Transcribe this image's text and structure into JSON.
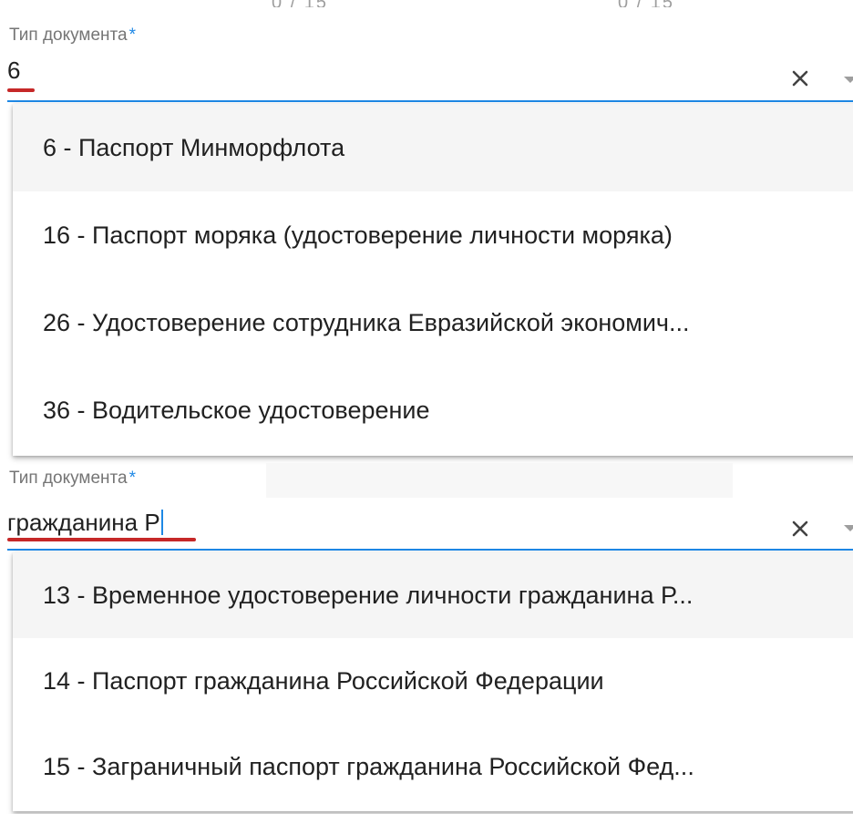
{
  "top_fragments": [
    "0 / 15",
    "0 / 15"
  ],
  "field1": {
    "label": "Тип документа",
    "required_mark": "*",
    "value": "6",
    "options": [
      "6 - Паспорт Минморфлота",
      "16 - Паспорт моряка (удостоверение личности моряка)",
      "26 - Удостоверение сотрудника Евразийской экономич...",
      "36 - Водительское удостоверение"
    ]
  },
  "field2": {
    "label": "Тип документа",
    "required_mark": "*",
    "value": "гражданина Р",
    "options": [
      "13 - Временное удостоверение личности гражданина Р...",
      "14 - Паспорт гражданина Российской Федерации",
      "15 - Заграничный паспорт гражданина Российской Фед..."
    ]
  },
  "colors": {
    "accent": "#1e88e5",
    "underline_annotation": "#c62828",
    "highlight_row": "#f5f5f5"
  }
}
